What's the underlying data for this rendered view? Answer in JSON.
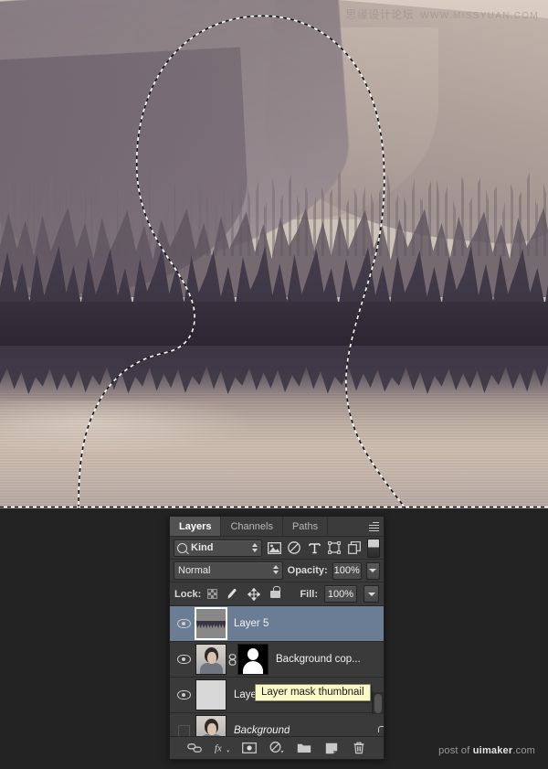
{
  "app": "Adobe Photoshop",
  "canvas": {
    "name": "image-canvas",
    "description": "Sepia-toned landscape photograph of a pine forest mountain reflected in a lake, with an active marching-ants selection in the shape of a human head profile",
    "selection_active": true
  },
  "watermark": {
    "cn": "思缘设计论坛",
    "en": "WWW.MISSYUAN.COM"
  },
  "credit": {
    "prefix": "post of ",
    "brand": "uimaker",
    "suffix": ".com"
  },
  "panel": {
    "tabs": [
      {
        "label": "Layers",
        "active": true
      },
      {
        "label": "Channels",
        "active": false
      },
      {
        "label": "Paths",
        "active": false
      }
    ],
    "menu_icon": "panel-menu-icon",
    "filter": {
      "icon": "search-icon",
      "kind_label": "Kind",
      "type_icons": [
        "pixel-layer-filter-icon",
        "adjustment-layer-filter-icon",
        "type-layer-filter-icon",
        "shape-layer-filter-icon",
        "smart-object-filter-icon"
      ],
      "toggle_name": "filter-enable-toggle"
    },
    "blend": {
      "mode": "Normal",
      "opacity_label": "Opacity:",
      "opacity_value": "100%",
      "fill_label": "Fill:",
      "fill_value": "100%"
    },
    "lock": {
      "label": "Lock:",
      "icons": [
        "lock-transparent-pixels-icon",
        "lock-image-pixels-icon",
        "lock-position-icon",
        "lock-all-icon"
      ]
    },
    "layers": [
      {
        "name": "Layer 5",
        "visible": true,
        "selected": true,
        "thumb": "landscape-thumbnail",
        "has_mask": false,
        "locked": false,
        "italic": false
      },
      {
        "name": "Background cop...",
        "visible": true,
        "selected": false,
        "thumb": "portrait-thumbnail",
        "has_mask": true,
        "mask_link_icon": "mask-link-icon",
        "locked": false,
        "italic": false
      },
      {
        "name": "Laye",
        "visible": true,
        "selected": false,
        "thumb": "gray-fill-thumbnail",
        "has_mask": false,
        "locked": false,
        "italic": false
      },
      {
        "name": "Background",
        "visible": false,
        "selected": false,
        "thumb": "portrait-thumbnail",
        "has_mask": false,
        "locked": true,
        "italic": true
      }
    ],
    "tooltip": {
      "text": "Layer mask thumbnail"
    },
    "footer_buttons": [
      "link-layers-icon",
      "layer-style-fx-icon",
      "add-layer-mask-icon",
      "new-adjustment-layer-icon",
      "new-group-icon",
      "new-layer-icon",
      "delete-layer-icon"
    ]
  },
  "colors": {
    "panel_bg": "#323232",
    "row_bg": "#3a3a3a",
    "selected_row": "#6b7d95",
    "tooltip_bg": "#fbf8c8",
    "desktop_bg": "#232323"
  }
}
